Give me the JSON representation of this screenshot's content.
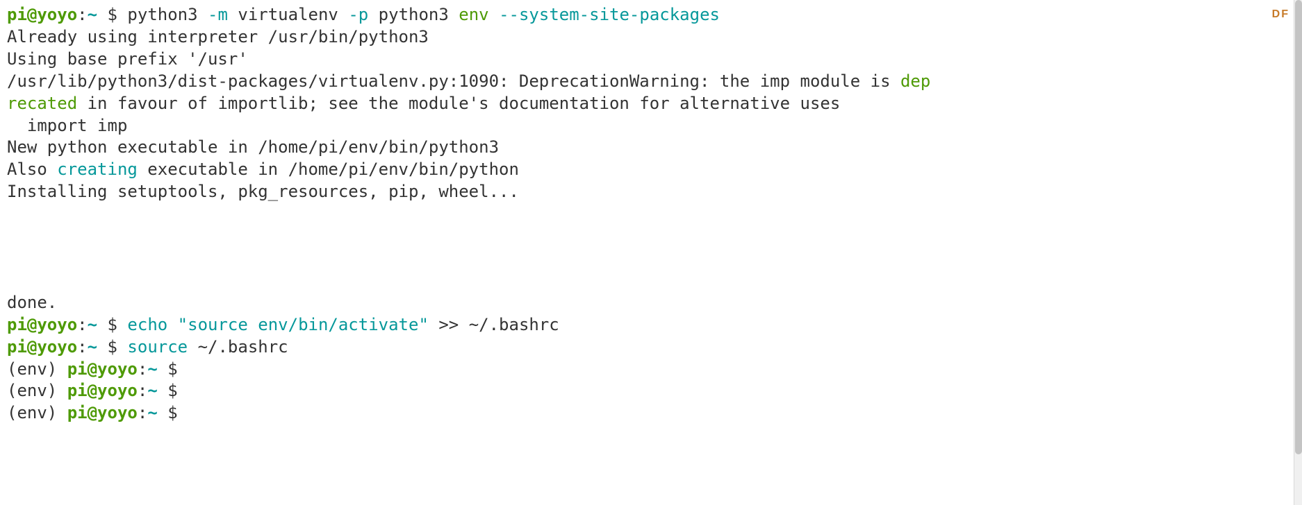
{
  "badge": "DF",
  "l1": {
    "prompt_user": "pi@yoyo",
    "colon": ":",
    "path": "~ ",
    "dollar": "$ ",
    "cmd_text": "python3 ",
    "opt_m": "-m",
    "mid": " virtualenv ",
    "opt_p": "-p",
    "after_p": " python3 ",
    "env": "env",
    "space": " ",
    "opt_ssp": "--system-site-packages"
  },
  "o1": "Already using interpreter /usr/bin/python3",
  "o2": "Using base prefix '/usr'",
  "o3_a": "/usr/lib/python3/dist-packages/virtualenv.py:1090: DeprecationWarning: the imp module is ",
  "o3_dep": "dep",
  "o3_recated": "recated",
  "o3_b": " in favour of importlib; see the module's documentation for alternative uses",
  "o4": "  import imp",
  "o5": "New python executable in /home/pi/env/bin/python3",
  "o6_a": "Also ",
  "o6_creating": "creating",
  "o6_b": " executable in /home/pi/env/bin/python",
  "o7": "Installing setuptools, pkg_resources, pip, wheel...",
  "blank": "",
  "o8": "done.",
  "l2": {
    "prompt_user": "pi@yoyo",
    "colon": ":",
    "path": "~ ",
    "dollar": "$ ",
    "cmd_head": "echo ",
    "quoted": "\"source env/bin/activate\"",
    "tail": " >> ~/.bashrc"
  },
  "l3": {
    "prompt_user": "pi@yoyo",
    "colon": ":",
    "path": "~ ",
    "dollar": "$ ",
    "cmd_head": "source",
    "tail": " ~/.bashrc"
  },
  "l4": {
    "env": "(env) ",
    "prompt_user": "pi@yoyo",
    "colon": ":",
    "path": "~ ",
    "dollar": "$ "
  },
  "l5": {
    "env": "(env) ",
    "prompt_user": "pi@yoyo",
    "colon": ":",
    "path": "~ ",
    "dollar": "$ "
  },
  "l6": {
    "env": "(env) ",
    "prompt_user": "pi@yoyo",
    "colon": ":",
    "path": "~ ",
    "dollar": "$ "
  }
}
